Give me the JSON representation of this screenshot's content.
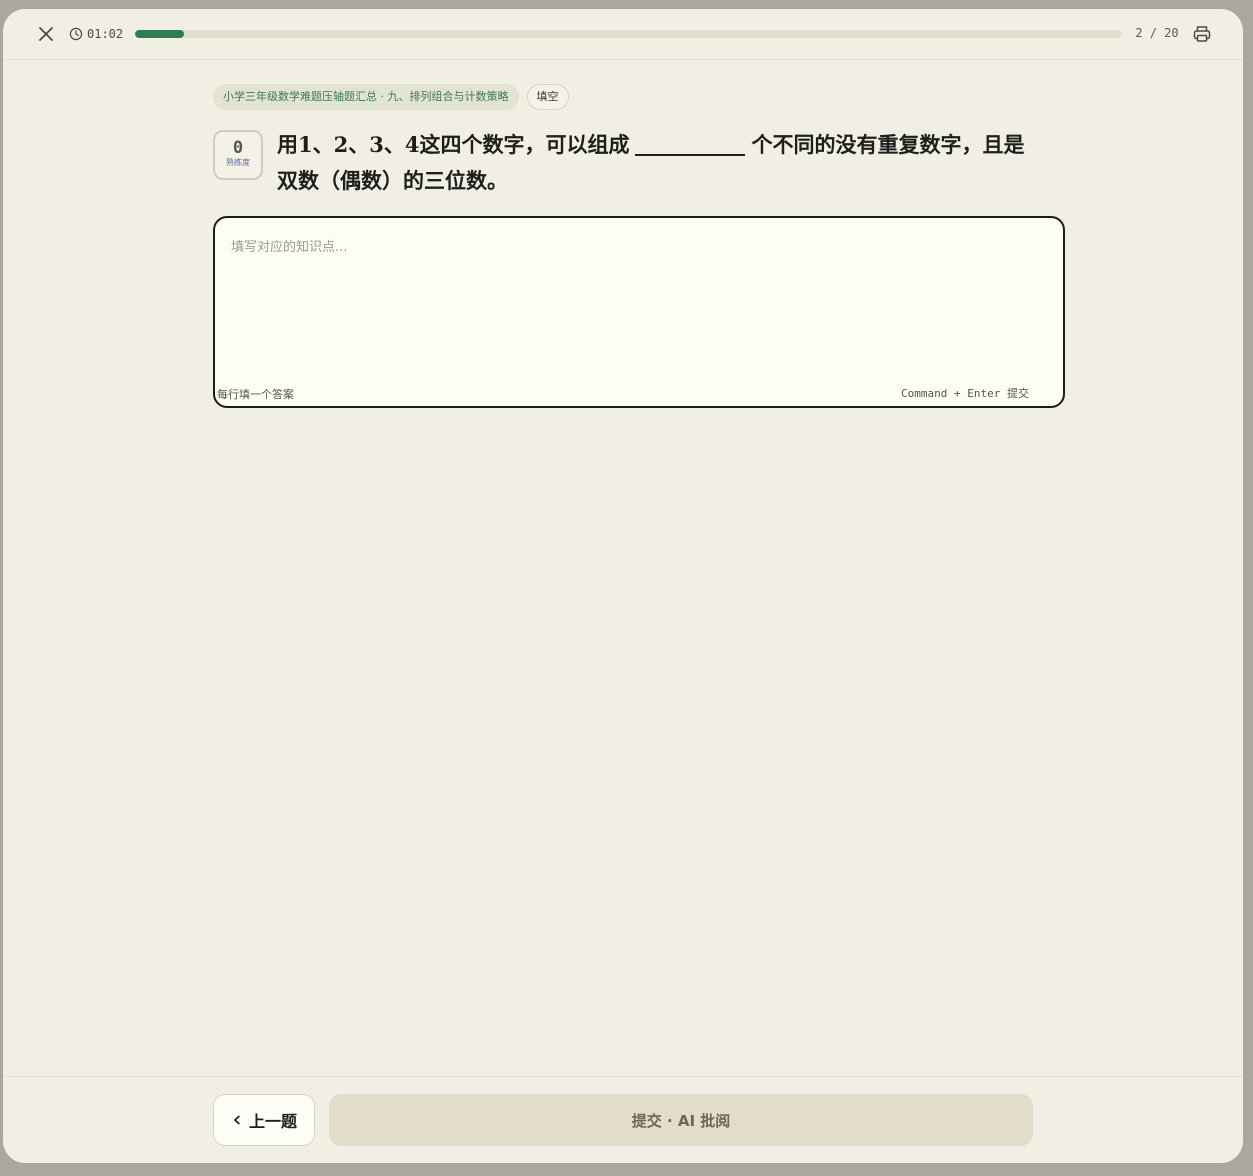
{
  "topbar": {
    "timer": "01:02",
    "progress_fraction": 0.05,
    "counter": "2 / 20",
    "progress_color": "#2e7d52"
  },
  "icons": {
    "close": "close-icon",
    "clock": "clock-icon",
    "print": "printer-icon",
    "prev": "chevron-left-icon"
  },
  "question": {
    "source_tag": "小学三年级数学难题压轴题汇总 · 九、排列组合与计数策略",
    "type_tag": "填空",
    "mastery_value": "0",
    "mastery_label": "熟练度",
    "text_before": "用1、2、3、4这四个数字，可以组成",
    "text_after": "个不同的没有重复数字，且是双数（偶数）的三位数。"
  },
  "answer": {
    "value": "",
    "placeholder": "填写对应的知识点...",
    "hint_left": "每行填一个答案",
    "hint_right": "Command + Enter 提交"
  },
  "footer": {
    "prev_label": "上一题",
    "submit_label": "提交 · AI 批阅"
  }
}
